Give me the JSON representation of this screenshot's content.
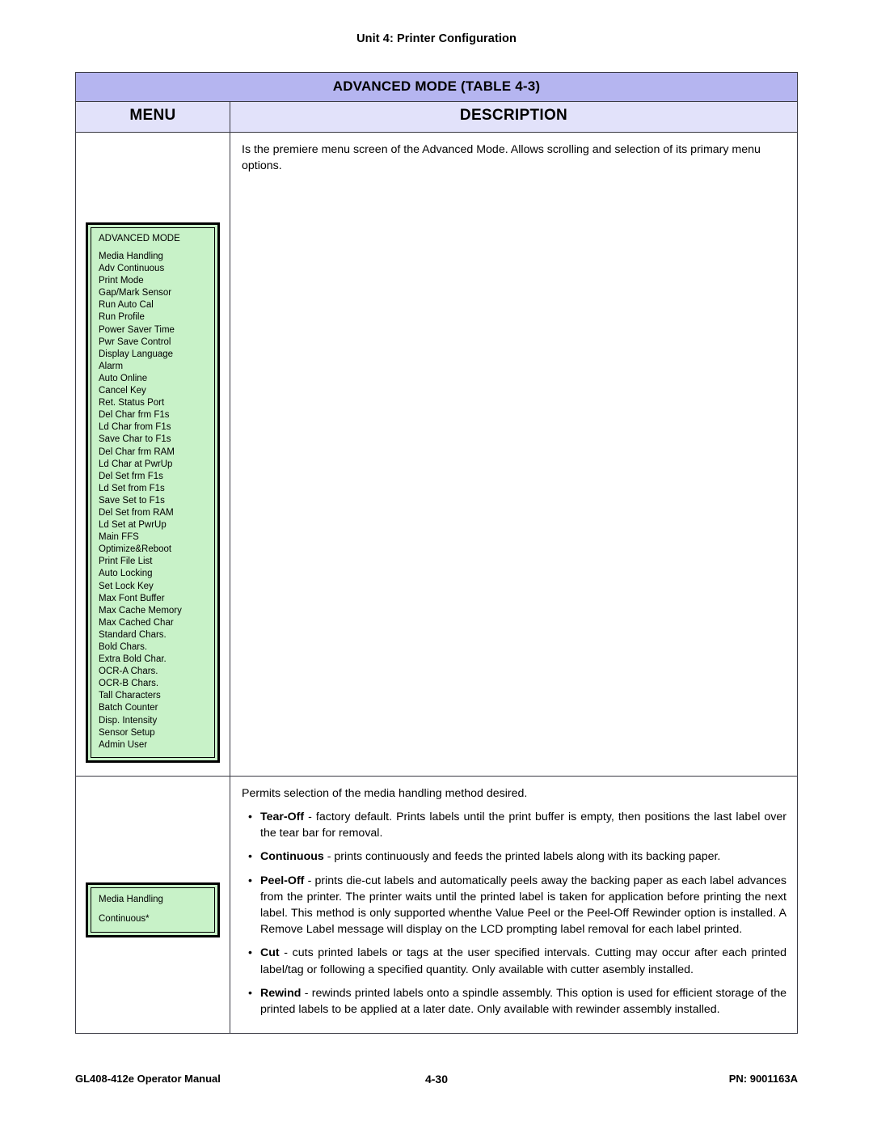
{
  "running_head": "Unit 4:  Printer Configuration",
  "table": {
    "title": "ADVANCED MODE (TABLE 4-3)",
    "columns": {
      "menu": "MENU",
      "description": "DESCRIPTION"
    },
    "rows": [
      {
        "menu_widget": {
          "type": "lcd-menu-list",
          "title": "ADVANCED MODE",
          "items": [
            "Media Handling",
            "Adv Continuous",
            "Print Mode",
            "Gap/Mark Sensor",
            "Run Auto Cal",
            "Run Profile",
            "Power Saver Time",
            "Pwr Save Control",
            "Display Language",
            "Alarm",
            "Auto Online",
            "Cancel Key",
            "Ret. Status Port",
            "Del Char frm F1s",
            "Ld Char from F1s",
            "Save Char to F1s",
            "Del Char frm RAM",
            "Ld Char at PwrUp",
            "Del Set frm F1s",
            "Ld Set from F1s",
            "Save Set to F1s",
            "Del Set from RAM",
            "Ld Set at PwrUp",
            "Main FFS",
            "Optimize&Reboot",
            "Print File List",
            "Auto Locking",
            "Set Lock Key",
            "Max Font Buffer",
            "Max Cache Memory",
            "Max Cached Char",
            "Standard Chars.",
            "Bold Chars.",
            "Extra Bold Char.",
            "OCR-A Chars.",
            "OCR-B Chars.",
            "Tall Characters",
            "Batch Counter",
            "Disp. Intensity",
            "Sensor Setup",
            "Admin User"
          ]
        },
        "description": {
          "intro": "Is the premiere menu screen of the Advanced Mode. Allows scrolling and selection of its primary menu options.",
          "bullets": []
        }
      },
      {
        "menu_widget": {
          "type": "lcd-two-line",
          "line1": "Media Handling",
          "line2": "Continuous*"
        },
        "description": {
          "intro": "Permits selection of the media handling method desired.",
          "bullets": [
            {
              "term": "Tear-Off",
              "text": " - factory default. Prints labels until the print buffer is empty, then positions the last label over the tear bar for removal."
            },
            {
              "term": "Continuous",
              "text": " -  prints continuously and feeds the printed labels along with its backing paper."
            },
            {
              "term": "Peel-Off",
              "text": " - prints die-cut labels and automatically peels away the backing paper as each label advances from the printer. The printer waits until the printed label is taken for application before printing the next label. This method is only supported whenthe Value Peel or the Peel-Off Rewinder option is installed. A Remove Label message will display on the LCD prompting label removal for each label printed."
            },
            {
              "term": "Cut",
              "text": " - cuts printed labels or tags at the user specified intervals. Cutting may occur after each printed label/tag or following a specified quantity. Only available with cutter asembly installed."
            },
            {
              "term": "Rewind",
              "text": " - rewinds printed labels onto a spindle assembly. This option is used for efficient storage of the printed labels to be applied at a later date. Only available with rewinder assembly installed."
            }
          ]
        }
      }
    ]
  },
  "bullet_glyph": "•",
  "footer": {
    "left": "GL408-412e Operator Manual",
    "center": "4-30",
    "right": "PN: 9001163A"
  },
  "colors": {
    "title_bar": "#b5b5f0",
    "header_row": "#e2e2fa",
    "lcd_screen": "#c8f2c8",
    "border": "#3a3a44"
  }
}
